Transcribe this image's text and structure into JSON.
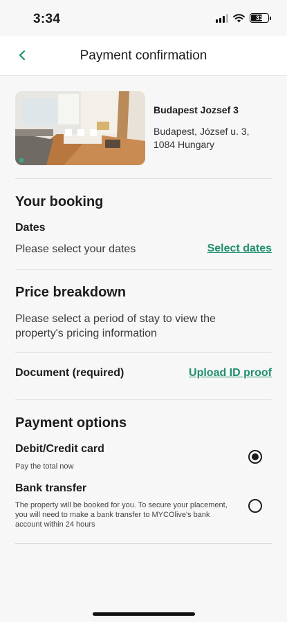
{
  "status_bar": {
    "time": "3:34",
    "battery": "31"
  },
  "header": {
    "title": "Payment confirmation"
  },
  "property": {
    "name": "Budapest Jozsef 3",
    "address": "Budapest, József u. 3, 1084 Hungary"
  },
  "booking": {
    "title": "Your booking",
    "dates_label": "Dates",
    "dates_prompt": "Please select your dates",
    "select_dates_link": "Select dates"
  },
  "price": {
    "title": "Price breakdown",
    "info": "Please select a period of stay to view the property's pricing information"
  },
  "document": {
    "label": "Document (required)",
    "upload_link": "Upload ID proof"
  },
  "payment": {
    "title": "Payment options",
    "options": [
      {
        "label": "Debit/Credit card",
        "description": "Pay the total now",
        "selected": true
      },
      {
        "label": "Bank transfer",
        "description": "The property will be booked for you. To secure your placement, you will need to make a bank transfer to MYCOlive's bank account within 24 hours",
        "selected": false
      }
    ]
  },
  "colors": {
    "accent": "#1f8f6e",
    "text": "#1c1c1c",
    "background": "#f7f7f7"
  }
}
